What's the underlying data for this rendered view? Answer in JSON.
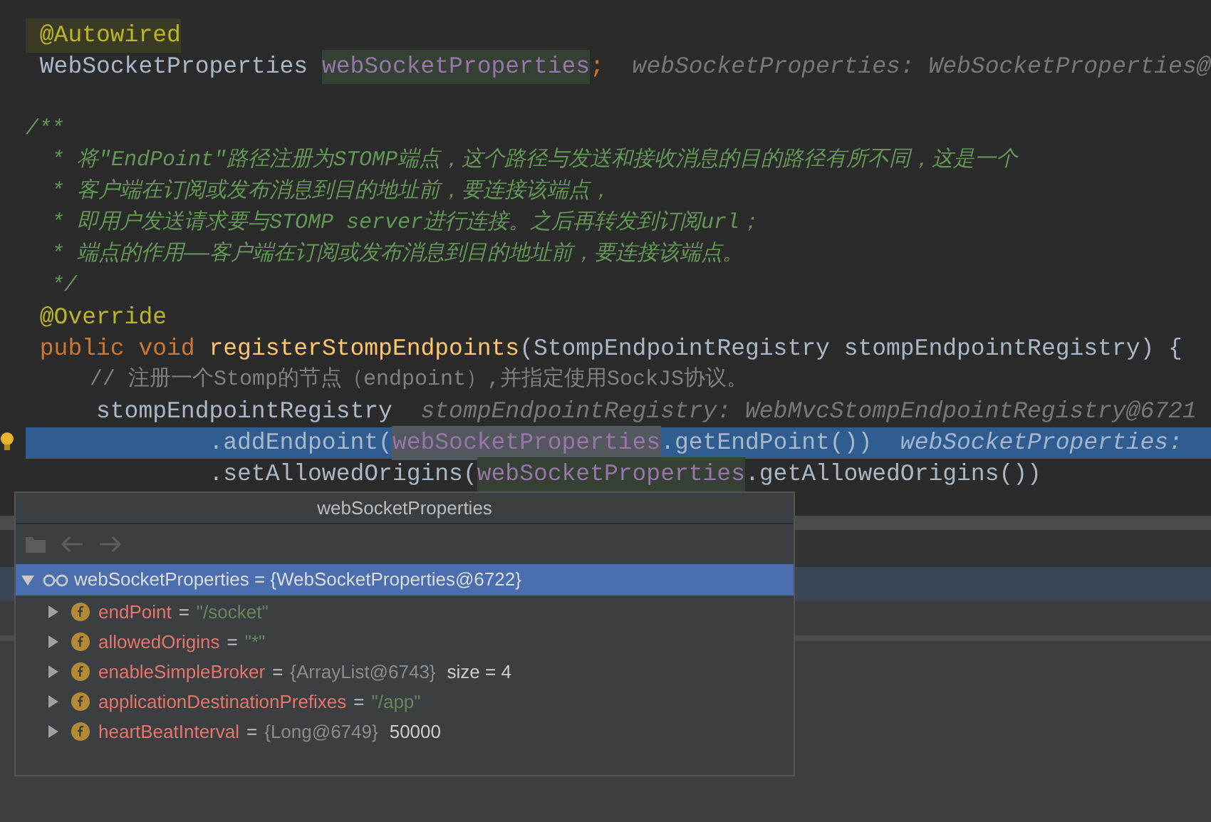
{
  "editor": {
    "lines": [
      {
        "kind": "code",
        "selected": false,
        "segments": [
          {
            "kind": "annotation_usage",
            "text": " @Autowired"
          }
        ]
      },
      {
        "kind": "code",
        "selected": false,
        "segments": [
          {
            "kind": "plain",
            "text": " WebSocketProperties "
          },
          {
            "kind": "field_usage",
            "text": "webSocketProperties"
          },
          {
            "kind": "keyword",
            "text": ";"
          },
          {
            "kind": "hint",
            "text": "  webSocketProperties: WebSocketProperties@"
          }
        ]
      },
      {
        "kind": "blank",
        "selected": false
      },
      {
        "kind": "code",
        "selected": false,
        "segments": [
          {
            "kind": "comment",
            "text": "/**"
          }
        ]
      },
      {
        "kind": "code",
        "selected": false,
        "segments": [
          {
            "kind": "comment",
            "text": "  * 将\"EndPoint\"路径注册为STOMP端点，这个路径与发送和接收消息的目的路径有所不同，这是一个"
          }
        ]
      },
      {
        "kind": "code",
        "selected": false,
        "segments": [
          {
            "kind": "comment",
            "text": "  * 客户端在订阅或发布消息到目的地址前，要连接该端点，"
          }
        ]
      },
      {
        "kind": "code",
        "selected": false,
        "segments": [
          {
            "kind": "comment",
            "text": "  * 即用户发送请求要与STOMP server进行连接。之后再转发到订阅url；"
          }
        ]
      },
      {
        "kind": "code",
        "selected": false,
        "segments": [
          {
            "kind": "comment",
            "text": "  * 端点的作用——客户端在订阅或发布消息到目的地址前，要连接该端点。"
          }
        ]
      },
      {
        "kind": "code",
        "selected": false,
        "segments": [
          {
            "kind": "comment",
            "text": "  */"
          }
        ]
      },
      {
        "kind": "code",
        "selected": false,
        "segments": [
          {
            "kind": "annotation",
            "text": " @Override"
          }
        ]
      },
      {
        "kind": "code",
        "selected": false,
        "segments": [
          {
            "kind": "keyword",
            "text": " public void "
          },
          {
            "kind": "method",
            "text": "registerStompEndpoints"
          },
          {
            "kind": "plain",
            "text": "(StompEndpointRegistry stompEndpointRegistry) {"
          }
        ]
      },
      {
        "kind": "code",
        "selected": false,
        "segments": [
          {
            "kind": "line_comment",
            "text": "     // 注册一个Stomp的节点（endpoint）,并指定使用SockJS协议。"
          }
        ]
      },
      {
        "kind": "code",
        "selected": false,
        "segments": [
          {
            "kind": "plain",
            "text": "     stompEndpointRegistry"
          },
          {
            "kind": "hint",
            "text": "  stompEndpointRegistry: WebMvcStompEndpointRegistry@6721"
          }
        ]
      },
      {
        "kind": "code",
        "selected": true,
        "segments": [
          {
            "kind": "plain",
            "text": "             .addEndpoint("
          },
          {
            "kind": "field_usage",
            "text": "webSocketProperties"
          },
          {
            "kind": "plain",
            "text": ".getEndPoint())"
          },
          {
            "kind": "hint",
            "text": "  webSocketProperties:"
          }
        ]
      },
      {
        "kind": "code",
        "selected": false,
        "segments": [
          {
            "kind": "plain",
            "text": "             .setAllowedOrigins("
          },
          {
            "kind": "field_usage",
            "text": "webSocketProperties"
          },
          {
            "kind": "plain",
            "text": ".getAllowedOrigins())"
          }
        ]
      }
    ]
  },
  "popup": {
    "title": "webSocketProperties",
    "toolbar": [
      {
        "kind": "folder",
        "disabled": true
      },
      {
        "kind": "back",
        "disabled": true
      },
      {
        "kind": "forward",
        "disabled": true
      }
    ],
    "root": {
      "label": "webSocketProperties = {WebSocketProperties@6722}",
      "expanded": true,
      "selected": true,
      "children": [
        {
          "name": "endPoint",
          "operator": "=",
          "kind": "string",
          "value": "\"/socket\"",
          "expanded": false,
          "selected": false
        },
        {
          "name": "allowedOrigins",
          "operator": "=",
          "kind": "string",
          "value": "\"*\"",
          "expanded": false,
          "selected": false
        },
        {
          "name": "enableSimpleBroker",
          "operator": "=",
          "kind": "object",
          "value": "{ArrayList@6743}",
          "extra": "size = 4",
          "expanded": false,
          "selected": false
        },
        {
          "name": "applicationDestinationPrefixes",
          "operator": "=",
          "kind": "string",
          "value": "\"/app\"",
          "expanded": false,
          "selected": false
        },
        {
          "name": "heartBeatInterval",
          "operator": "=",
          "kind": "object",
          "value": "{Long@6749}",
          "extra": "50000",
          "expanded": false,
          "selected": false
        }
      ]
    }
  }
}
